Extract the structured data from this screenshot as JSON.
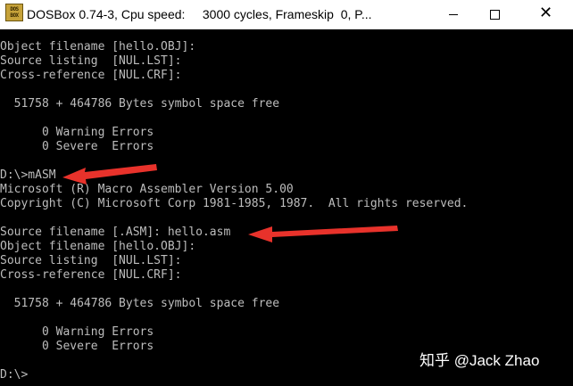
{
  "window": {
    "title": "DOSBox 0.74-3, Cpu speed:     3000 cycles, Frameskip  0, P...",
    "icon": "dosbox-icon",
    "icon_text": [
      "DOS",
      "BOX"
    ],
    "controls": {
      "minimize": "minimize-icon",
      "maximize": "maximize-icon",
      "close": "close-icon",
      "close_glyph": "✕"
    }
  },
  "console": {
    "lines": [
      "Object filename [hello.OBJ]:",
      "Source listing  [NUL.LST]:",
      "Cross-reference [NUL.CRF]:",
      "",
      "  51758 + 464786 Bytes symbol space free",
      "",
      "      0 Warning Errors",
      "      0 Severe  Errors",
      "",
      "D:\\>mASM",
      "Microsoft (R) Macro Assembler Version 5.00",
      "Copyright (C) Microsoft Corp 1981-1985, 1987.  All rights reserved.",
      "",
      "Source filename [.ASM]: hello.asm",
      "Object filename [hello.OBJ]:",
      "Source listing  [NUL.LST]:",
      "Cross-reference [NUL.CRF]:",
      "",
      "  51758 + 464786 Bytes symbol space free",
      "",
      "      0 Warning Errors",
      "      0 Severe  Errors",
      "",
      "D:\\>"
    ]
  },
  "annotations": {
    "arrow_color": "#e8322b"
  },
  "watermark": {
    "text": "知乎 @Jack Zhao"
  }
}
